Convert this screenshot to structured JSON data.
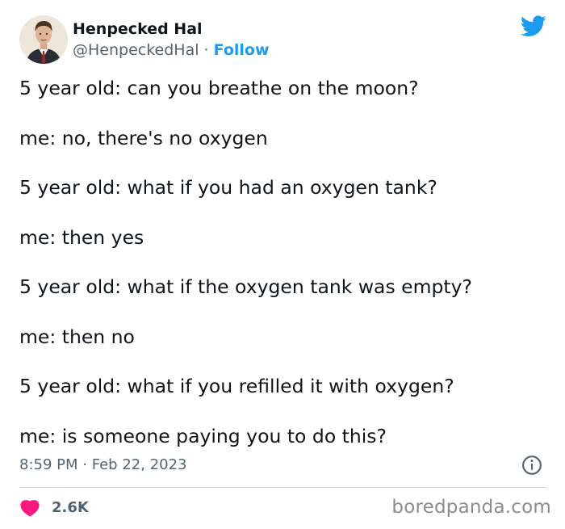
{
  "author": {
    "display_name": "Henpecked Hal",
    "handle": "@HenpeckedHal",
    "separator": "·",
    "follow_label": "Follow",
    "avatar_icon": "person-portrait-avatar"
  },
  "brand_icon": "twitter-bird-icon",
  "brand_color": "#1d9bf0",
  "tweet_lines": [
    "5 year old: can you breathe on the moon?",
    "me: no, there's no oxygen",
    "5 year old: what if you had an oxygen tank?",
    "me: then yes",
    "5 year old: what if the oxygen tank was empty?",
    "me: then no",
    "5 year old: what if you refilled it with oxygen?",
    "me: is someone paying you to do this?"
  ],
  "meta": {
    "time": "8:59 PM",
    "separator": "·",
    "date": "Feb 22, 2023",
    "info_icon": "info-icon"
  },
  "engagement": {
    "like_icon": "heart-icon",
    "like_color": "#f91880",
    "like_count": "2.6K"
  },
  "watermark": "boredpanda.com"
}
